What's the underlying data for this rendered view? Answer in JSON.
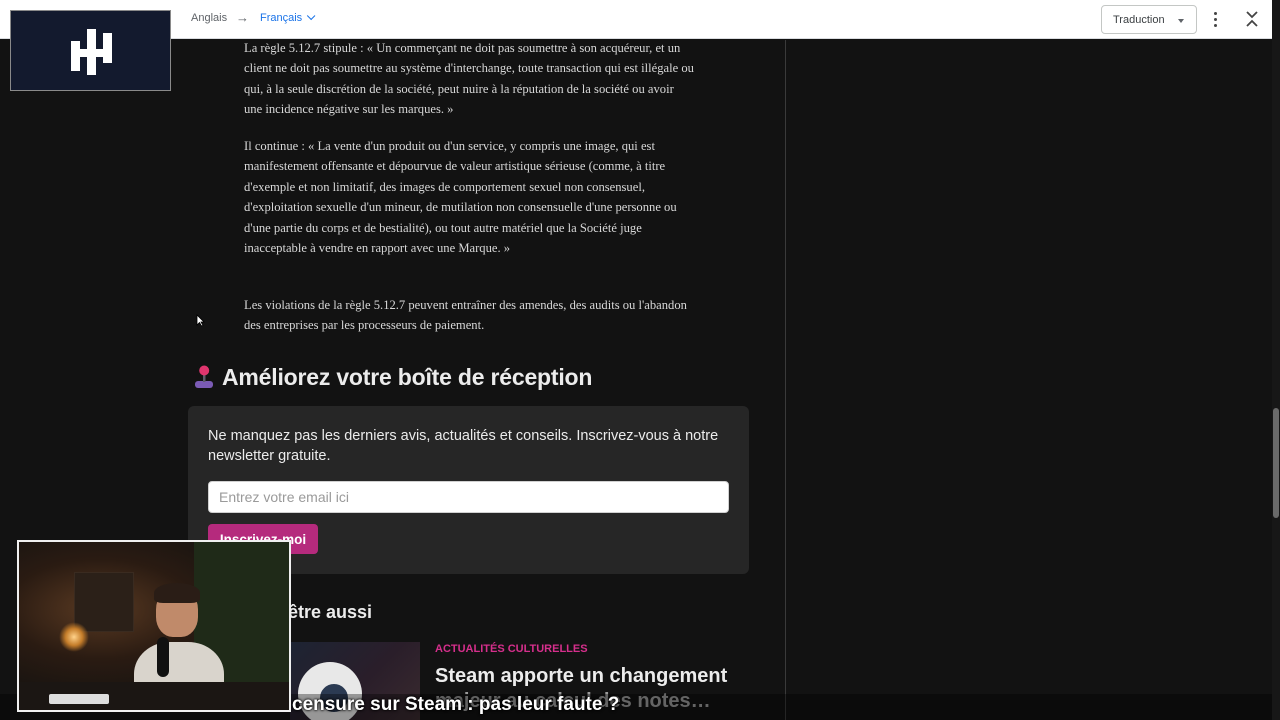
{
  "translate_bar": {
    "source_lang": "Anglais",
    "arrow": "→",
    "target_lang": "Français",
    "mode_select": "Traduction"
  },
  "article": {
    "paragraphs": [
      "La règle 5.12.7 stipule : « Un commerçant ne doit pas soumettre à son acquéreur, et un client ne doit pas soumettre au système d'interchange, toute transaction qui est illégale ou qui, à la seule discrétion de la société, peut nuire à la réputation de la société ou avoir une incidence négative sur les marques. »",
      "Il continue : « La vente d'un produit ou d'un service, y compris une image, qui est manifestement offensante et dépourvue de valeur artistique sérieuse (comme, à titre d'exemple et non limitatif, des images de comportement sexuel non consensuel, d'exploitation sexuelle d'un mineur, de mutilation non consensuelle d'une personne ou d'une partie du corps et de bestialité), ou tout autre matériel que la Société juge inacceptable à vendre en rapport avec une Marque. »",
      "Les violations de la règle 5.12.7 peuvent entraîner des amendes, des audits ou l'abandon des entreprises par les processeurs de paiement."
    ]
  },
  "newsletter": {
    "heading": "Améliorez votre boîte de réception",
    "description": "Ne manquez pas les derniers avis, actualités et conseils. Inscrivez-vous à notre newsletter gratuite.",
    "email_placeholder": "Entrez votre email ici",
    "subscribe_label": "Inscrivez-moi"
  },
  "related": {
    "heading": "z peut-être aussi",
    "card": {
      "category": "ACTUALITÉS CULTURELLES",
      "title_line1": "Steam apporte un changement",
      "title_line2": "majeur au calcul des notes…"
    }
  },
  "caption": "censure sur Steam : pas leur faute ?",
  "colors": {
    "accent": "#b52a7d",
    "category": "#d62f8c",
    "link_blue": "#1a73e8",
    "page_bg": "#121212",
    "card_bg": "#262626"
  },
  "icons": [
    "logo-icon",
    "chevron-down-icon",
    "dropdown-triangle-icon",
    "more-vert-icon",
    "collapse-icon",
    "joystick-icon",
    "steam-icon",
    "mouse-cursor-icon"
  ]
}
